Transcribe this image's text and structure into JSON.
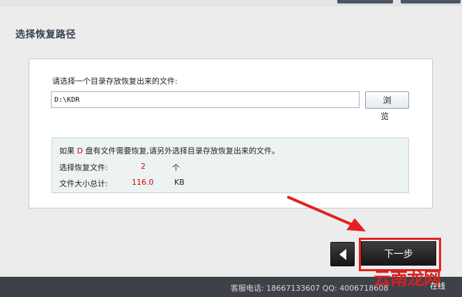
{
  "section_title": "选择恢复路径",
  "prompt": "请选择一个目录存放恢复出来的文件:",
  "path_value": "D:\\KDR",
  "browse_label": "浏 览",
  "info": {
    "line1_prefix": "如果 ",
    "drive": "D",
    "line1_suffix": " 盘有文件需要恢复,请另外选择目录存放恢复出来的文件。",
    "count_label": "选择恢复文件:",
    "count_value": "2",
    "count_unit": "个",
    "size_label": "文件大小总计:",
    "size_value": "116.0",
    "size_unit": "KB"
  },
  "next_label": "下一步",
  "footer": {
    "hotline": "客服电话: 18667133607 QQ: 4006718608",
    "watermark": "云南龙网",
    "online": "在线"
  },
  "colors": {
    "accent_red": "#d60000",
    "highlight_border": "#e32121",
    "dark_button": "#1f1f1f"
  },
  "icons": {
    "back": "left-triangle-icon",
    "arrow": "red-pointer-arrow"
  }
}
